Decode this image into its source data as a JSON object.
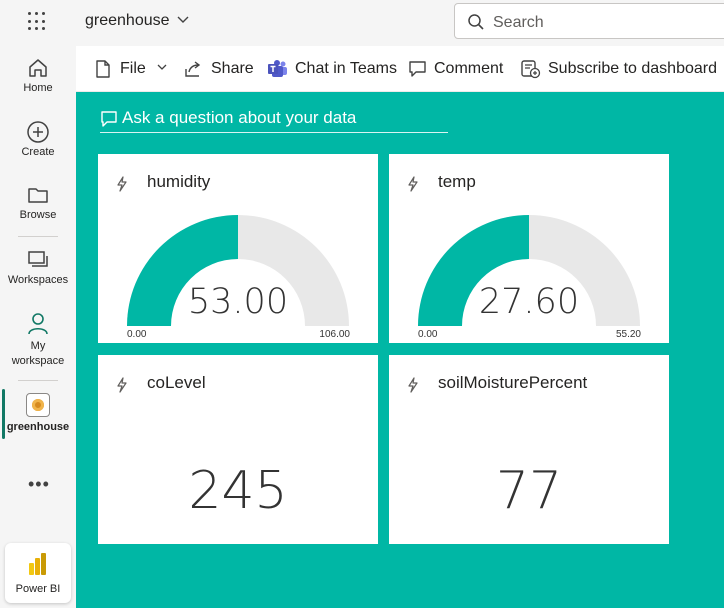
{
  "header": {
    "workspace_title": "greenhouse",
    "search_placeholder": "Search"
  },
  "leftnav": {
    "items": [
      {
        "label": "Home",
        "icon": "home-icon"
      },
      {
        "label": "Create",
        "icon": "plus-circle-icon"
      },
      {
        "label": "Browse",
        "icon": "folder-icon"
      },
      {
        "label": "Workspaces",
        "icon": "workspaces-icon"
      },
      {
        "label": "My workspace",
        "icon": "person-icon"
      },
      {
        "label": "greenhouse",
        "icon": "workspace-icon"
      }
    ],
    "more": "•••",
    "product": "Power BI"
  },
  "toolbar": {
    "file": "File",
    "share": "Share",
    "chat": "Chat in Teams",
    "comment": "Comment",
    "subscribe": "Subscribe to dashboard"
  },
  "dashboard": {
    "qa_prompt": "Ask a question about your data",
    "canvas_color": "#00b7a5",
    "gauges": [
      {
        "title": "humidity",
        "value": 53.0,
        "value_label": "53.00",
        "min": "0.00",
        "max": "106.00"
      },
      {
        "title": "temp",
        "value": 27.6,
        "value_label": "27.60",
        "min": "0.00",
        "max": "55.20"
      }
    ],
    "cards": [
      {
        "title": "coLevel",
        "value": "245"
      },
      {
        "title": "soilMoisturePercent",
        "value": "77"
      }
    ]
  }
}
